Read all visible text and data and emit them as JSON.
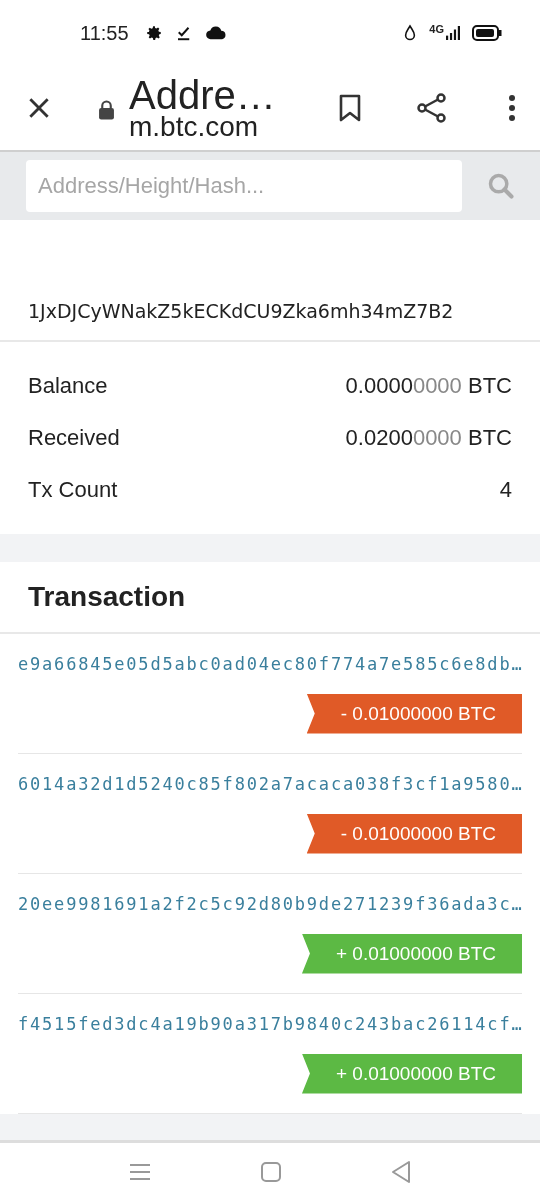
{
  "status_bar": {
    "time": "11:55",
    "network": "4G"
  },
  "toolbar": {
    "title": "Addre…",
    "url": "m.btc.com"
  },
  "search": {
    "placeholder": "Address/Height/Hash..."
  },
  "address": "1JxDJCyWNakZ5kECKdCU9Zka6mh34mZ7B2",
  "stats": [
    {
      "label": "Balance",
      "value": "0.0000",
      "dim": "0000",
      "unit": "BTC"
    },
    {
      "label": "Received",
      "value": "0.0200",
      "dim": "0000",
      "unit": "BTC"
    },
    {
      "label": "Tx Count",
      "value": "4"
    }
  ],
  "transactions_title": "Transaction",
  "transactions": [
    {
      "hash": "e9a66845e05d5abc0ad04ec80f774a7e585c6e8db…",
      "amount": "- 0.01000000 BTC",
      "kind": "out"
    },
    {
      "hash": "6014a32d1d5240c85f802a7acaca038f3cf1a9580…",
      "amount": "- 0.01000000 BTC",
      "kind": "out"
    },
    {
      "hash": "20ee9981691a2f2c5c92d80b9de271239f36ada3c…",
      "amount": "+ 0.01000000 BTC",
      "kind": "in"
    },
    {
      "hash": "f4515fed3dc4a19b90a317b9840c243bac26114cf…",
      "amount": "+ 0.01000000 BTC",
      "kind": "in"
    }
  ]
}
